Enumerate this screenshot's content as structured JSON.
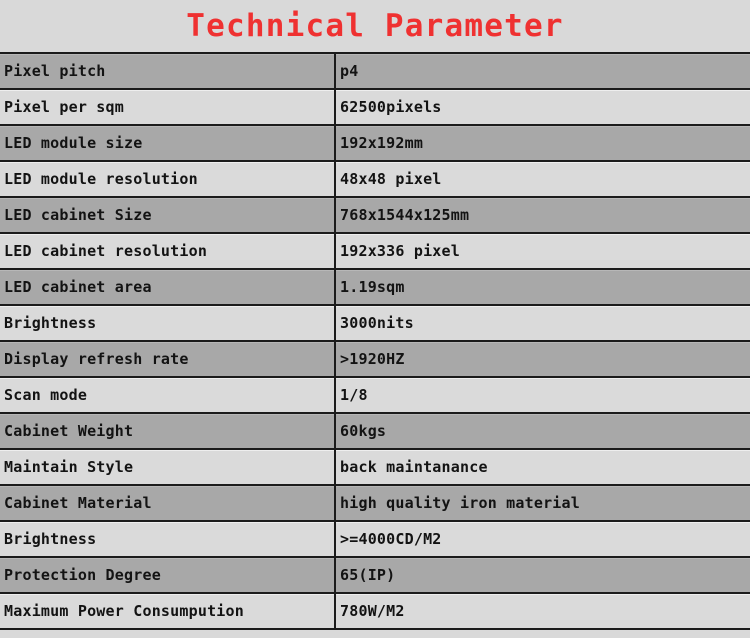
{
  "title": "Technical Parameter",
  "colors": {
    "title_red": "#ef3131",
    "row_dark": "#a8a8a8",
    "row_light": "#dadada",
    "page_background": "#d9d9d9",
    "border": "#1b1b1b",
    "text": "#131313"
  },
  "table": {
    "rows": [
      {
        "name": "Pixel pitch",
        "value": "p4"
      },
      {
        "name": "Pixel per sqm",
        "value": "62500pixels"
      },
      {
        "name": "LED module size",
        "value": "192x192mm"
      },
      {
        "name": "LED module resolution",
        "value": "48x48 pixel"
      },
      {
        "name": "LED cabinet Size",
        "value": "768x1544x125mm"
      },
      {
        "name": "LED cabinet resolution",
        "value": "192x336 pixel"
      },
      {
        "name": "LED cabinet area",
        "value": "1.19sqm"
      },
      {
        "name": "Brightness",
        "value": "3000nits"
      },
      {
        "name": "Display refresh rate",
        "value": ">1920HZ"
      },
      {
        "name": "Scan mode",
        "value": "1/8"
      },
      {
        "name": "Cabinet Weight",
        "value": "60kgs"
      },
      {
        "name": "Maintain Style",
        "value": "back maintanance"
      },
      {
        "name": "Cabinet Material",
        "value": "high quality iron material"
      },
      {
        "name": "Brightness",
        "value": ">=4000CD/M2"
      },
      {
        "name": "Protection Degree",
        "value": "65(IP)"
      },
      {
        "name": "Maximum Power Consumpution",
        "value": "780W/M2"
      }
    ]
  }
}
